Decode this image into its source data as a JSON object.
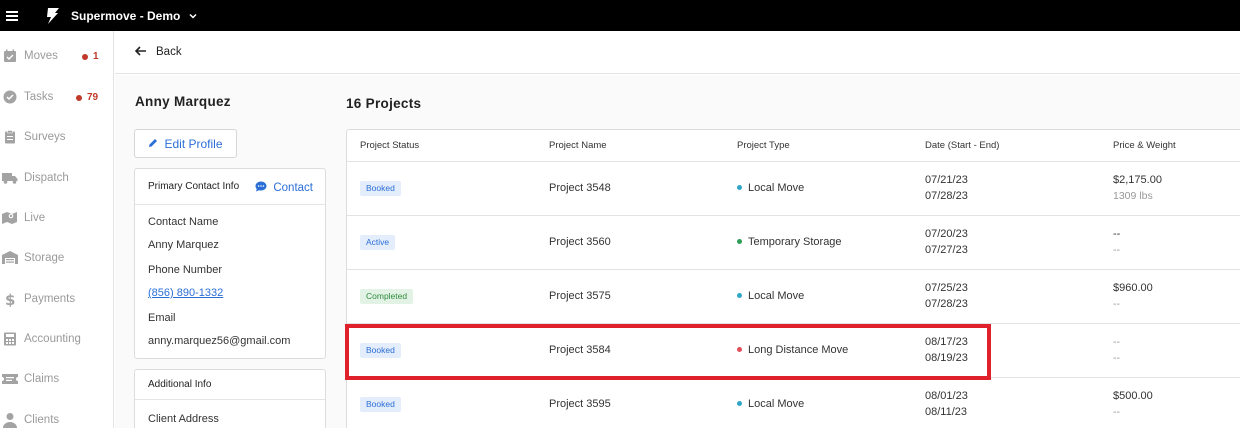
{
  "app": {
    "title": "Supermove - Demo"
  },
  "colors": {
    "accent": "#2b6fd6",
    "badge_red": "#c0392b",
    "highlight": "#e0202a"
  },
  "sidebar": {
    "items": [
      {
        "label": "Moves",
        "icon": "calendar-check-icon",
        "badge": "1"
      },
      {
        "label": "Tasks",
        "icon": "check-circle-icon",
        "badge": "79"
      },
      {
        "label": "Surveys",
        "icon": "clipboard-icon"
      },
      {
        "label": "Dispatch",
        "icon": "truck-icon"
      },
      {
        "label": "Live",
        "icon": "map-icon"
      },
      {
        "label": "Storage",
        "icon": "warehouse-icon"
      },
      {
        "label": "Payments",
        "icon": "dollar-icon"
      },
      {
        "label": "Accounting",
        "icon": "calculator-icon"
      },
      {
        "label": "Claims",
        "icon": "ticket-icon"
      },
      {
        "label": "Clients",
        "icon": "user-icon"
      }
    ]
  },
  "back": {
    "label": "Back"
  },
  "client": {
    "name": "Anny Marquez",
    "edit_label": "Edit Profile",
    "primary_contact": {
      "title": "Primary Contact Info",
      "contact_label": "Contact",
      "contact_name_label": "Contact Name",
      "contact_name": "Anny Marquez",
      "phone_label": "Phone Number",
      "phone": "(856) 890-1332",
      "email_label": "Email",
      "email": "anny.marquez56@gmail.com"
    },
    "additional": {
      "title": "Additional Info",
      "address_label": "Client Address"
    }
  },
  "projects": {
    "count_label": "16 Projects",
    "columns": [
      "Project Status",
      "Project Name",
      "Project Type",
      "Date (Start - End)",
      "Price & Weight"
    ],
    "rows": [
      {
        "status": "Booked",
        "name": "Project 3548",
        "type": "Local Move",
        "type_color": "#2fa7c9",
        "start": "07/21/23",
        "end": "07/28/23",
        "price": "$2,175.00",
        "weight": "1309 lbs"
      },
      {
        "status": "Active",
        "name": "Project 3560",
        "type": "Temporary Storage",
        "type_color": "#2e9e54",
        "start": "07/20/23",
        "end": "07/27/23",
        "price": "--",
        "weight": "--"
      },
      {
        "status": "Completed",
        "name": "Project 3575",
        "type": "Local Move",
        "type_color": "#2fa7c9",
        "start": "07/25/23",
        "end": "07/28/23",
        "price": "$960.00",
        "weight": "--"
      },
      {
        "status": "Booked",
        "name": "Project 3584",
        "type": "Long Distance Move",
        "type_color": "#e0505a",
        "start": "08/17/23",
        "end": "08/19/23",
        "price": "--",
        "weight": "--"
      },
      {
        "status": "Booked",
        "name": "Project 3595",
        "type": "Local Move",
        "type_color": "#2fa7c9",
        "start": "08/01/23",
        "end": "08/11/23",
        "price": "$500.00",
        "weight": "--"
      }
    ]
  }
}
